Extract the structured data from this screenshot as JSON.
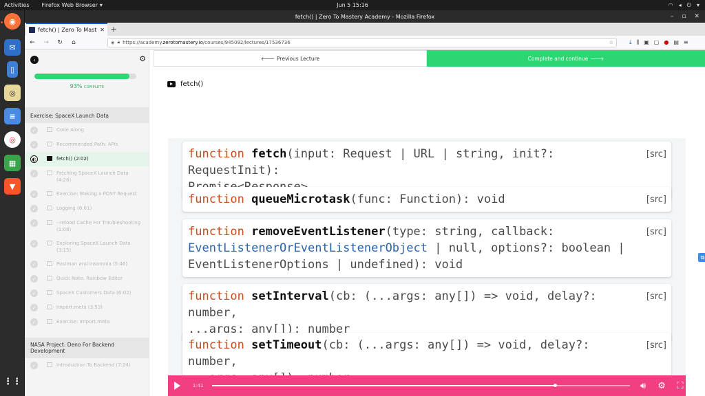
{
  "topbar": {
    "activities": "Activities",
    "app_name": "Firefox Web Browser",
    "clock": "Jun 5  15:16"
  },
  "window": {
    "title": "fetch() | Zero To Mastery Academy - Mozilla Firefox"
  },
  "tab": {
    "title": "fetch() | Zero To Mastery"
  },
  "url": {
    "prefix": "https://academy.",
    "host": "zerotomastery.io",
    "path": "/courses/945092/lectures/17536736"
  },
  "sidebar": {
    "progress_percent": 93,
    "progress_value": "93%",
    "progress_suffix": "COMPLETE",
    "section1": "Exercise: SpaceX Launch Data",
    "lessons": [
      {
        "label": "Code Along",
        "icon": "doc"
      },
      {
        "label": "Recommended Path: APIs",
        "icon": "doc"
      },
      {
        "label": "fetch() (2:02)",
        "icon": "play",
        "active": true
      },
      {
        "label": "Fetching SpaceX Launch Data (4:26)",
        "icon": "play"
      },
      {
        "label": "Exercise: Making a POST Request",
        "icon": "doc"
      },
      {
        "label": "Logging (6:01)",
        "icon": "play"
      },
      {
        "label": "--reload Cache For Troubleshooting (1:08)",
        "icon": "play"
      },
      {
        "label": "Exploring SpaceX Launch Data (3:15)",
        "icon": "play"
      },
      {
        "label": "Postman and Insomnia (5:46)",
        "icon": "play"
      },
      {
        "label": "Quick Note: Rainbow Editor",
        "icon": "doc"
      },
      {
        "label": "SpaceX Customers Data (6:02)",
        "icon": "play"
      },
      {
        "label": "Import.meta (3:53)",
        "icon": "play"
      },
      {
        "label": "Exercise: Import.meta",
        "icon": "doc"
      }
    ],
    "section2": "NASA Project: Deno For Backend Development",
    "lessons2": [
      {
        "label": "Introduction To Backend (7:24)",
        "icon": "play"
      }
    ]
  },
  "lecture_nav": {
    "prev": "Previous Lecture",
    "next": "Complete and continue"
  },
  "lecture": {
    "title": "fetch()"
  },
  "video": {
    "time": "1:41",
    "progress_fraction": 0.82,
    "cards": [
      {
        "kw": "function",
        "name": "fetch",
        "sig_a": "(input: Request | URL | string, init?: RequestInit):",
        "type_link": "",
        "sig_b": "Promise<Response>",
        "src": "[src]"
      },
      {
        "kw": "function",
        "name": "queueMicrotask",
        "sig_a": "(func: Function): void",
        "type_link": "",
        "sig_b": "",
        "src": "[src]"
      },
      {
        "kw": "function",
        "name": "removeEventListener",
        "sig_a": "(type: string, callback:",
        "type_link": "EventListenerOrEventListenerObject",
        "sig_b": " | null, options?: boolean | EventListenerOptions | undefined): void",
        "src": "[src]"
      },
      {
        "kw": "function",
        "name": "setInterval",
        "sig_a": "(cb: (...args: any[]) => void, delay?: number,",
        "type_link": "",
        "sig_b": "...args: any[]): number",
        "src": "[src]"
      },
      {
        "kw": "function",
        "name": "setTimeout",
        "sig_a": "(cb: (...args: any[]) => void, delay?: number,",
        "type_link": "",
        "sig_b": "...args: any[]): number",
        "src": "[src]"
      }
    ]
  },
  "colors": {
    "accent_green": "#2ed573",
    "player_pink": "#f23f82"
  }
}
